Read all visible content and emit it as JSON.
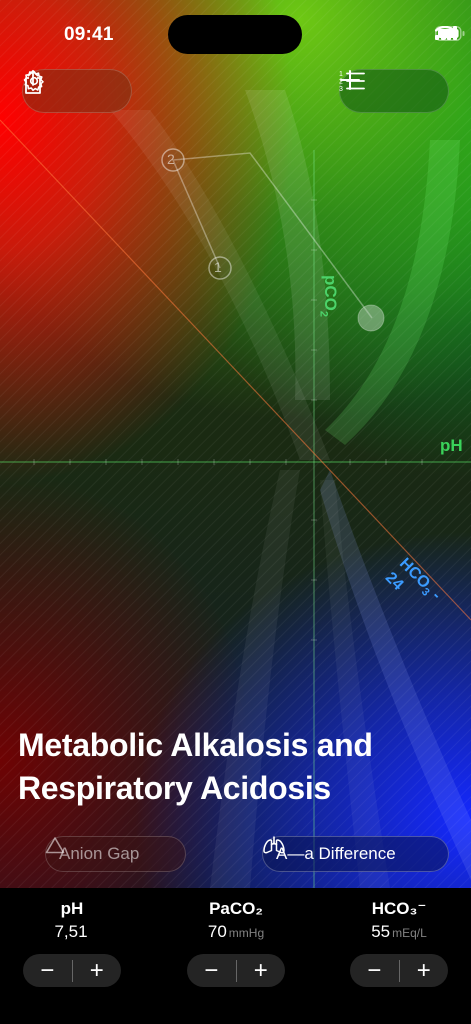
{
  "status_bar": {
    "time": "09:41"
  },
  "toolbar": {
    "settings_icon": "gear-icon",
    "share_icon": "share-icon",
    "list_icon": "numbered-list-icon",
    "add_icon": "plus-icon"
  },
  "diagram": {
    "axis_pco2": "pCO",
    "axis_pco2_sub": "2",
    "axis_ph": "pH",
    "axis_hco3": "HCO",
    "axis_hco3_sub": "3",
    "axis_hco3_suffix": " - 24",
    "point_1": "1",
    "point_2": "2"
  },
  "diagnosis": {
    "title_line1": "Metabolic Alkalosis and",
    "title_line2": "Respiratory Acidosis"
  },
  "chips": {
    "anion_gap": "Anion Gap",
    "aa_difference": "A—a Difference"
  },
  "controls": [
    {
      "label": "pH",
      "value": "7,51",
      "unit": ""
    },
    {
      "label": "PaCO₂",
      "value": "70",
      "unit": "mmHg"
    },
    {
      "label": "HCO₃⁻",
      "value": "55",
      "unit": "mEq/L"
    }
  ],
  "stepper": {
    "minus": "−",
    "plus": "+"
  },
  "colors": {
    "accent_green": "#3ad35a",
    "accent_blue": "#3b9bff",
    "background": "#000000"
  }
}
